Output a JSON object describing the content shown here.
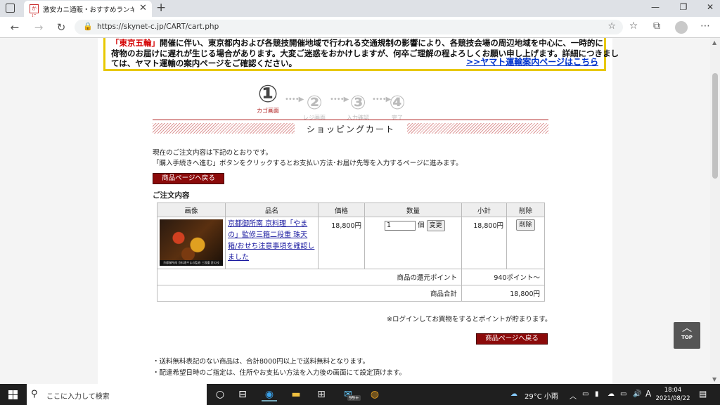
{
  "browser": {
    "tab_title": "激安カニ通販・おすすめランキング・カ",
    "favicon_text": "かに",
    "url": "https://skynet-c.jp/CART/cart.php"
  },
  "notice": {
    "line1_prefix": "「東京五輪」",
    "line1_rest": "開催に伴い、東京都内および各競技開催地域で行われる交通規制の影響により、各競技会場の周辺地域を中心に、一時的に",
    "line2": "荷物のお届けに遅れが生じる場合があります。大変ご迷惑をおかけしますが、何卒ご理解の程よろしくお願い申し上げます。詳細につきまし",
    "line3": "ては、ヤマト運輸の案内ページをご確認ください。",
    "link": ">>ヤマト運輸案内ページはこちら"
  },
  "steps": [
    {
      "num": "①",
      "label": "カゴ画面"
    },
    {
      "num": "②",
      "label": "レジ画面"
    },
    {
      "num": "③",
      "label": "入力確認"
    },
    {
      "num": "④",
      "label": "完了"
    }
  ],
  "step_arrow": "••••▶",
  "heading": "ショッピングカート",
  "intro1": "現在のご注文内容は下記のとおりです。",
  "intro2": "「購入手続きへ進む」ボタンをクリックするとお支払い方法･お届け先等を入力するページに進みます。",
  "back_button": "商品ページへ戻る",
  "order_label": "ご注文内容",
  "table": {
    "headers": [
      "画像",
      "品名",
      "価格",
      "数量",
      "小計",
      "削除"
    ],
    "item": {
      "image_caption": "京都御所南 京料理やまの監修 三段重 匠の技",
      "name": "京都御所南 京料理「やまの」監修三箱二段重 珠天箱/おせち注意事項を確認しました",
      "price": "18,800円",
      "qty": "1",
      "qty_unit": "個",
      "change_button": "変更",
      "subtotal": "18,800円",
      "delete_button": "削除"
    },
    "points_label": "商品の還元ポイント",
    "points_value": "940ポイント～",
    "total_label": "商品合計",
    "total_value": "18,800円"
  },
  "login_note": "※ログインしてお買物をするとポイントが貯まります。",
  "bottom_notes": [
    "・送料無料表記のない商品は、合計8000円以上で送料無料となります。",
    "・配達希望日時のご指定は、住所やお支払い方法を入力後の画面にて設定頂けます。"
  ],
  "top_button": "TOP",
  "taskbar": {
    "search_placeholder": "ここに入力して検索",
    "badge": "99+",
    "weather": "29°C 小雨",
    "ime": "A",
    "time": "18:04",
    "date": "2021/08/22"
  }
}
